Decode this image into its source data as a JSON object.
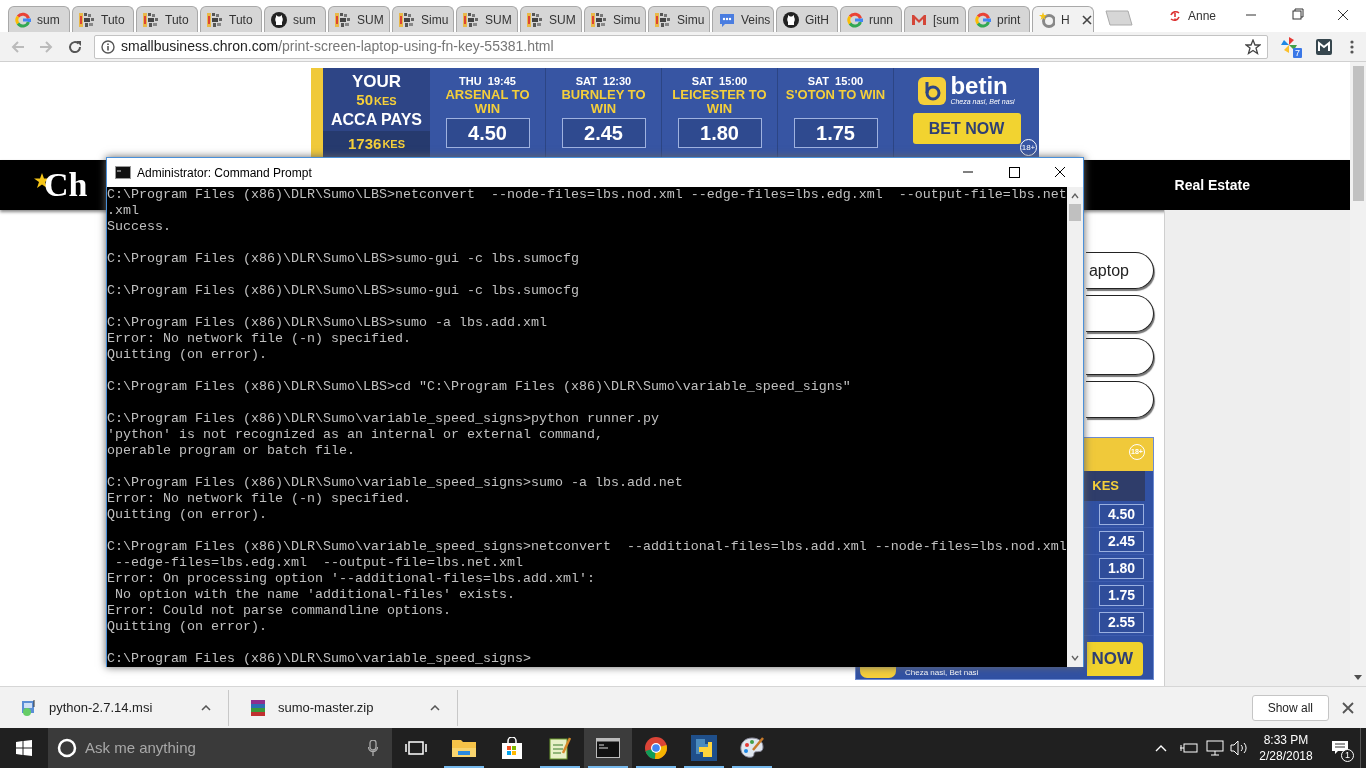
{
  "browser": {
    "tabs": [
      {
        "title": "sum",
        "kind": "ring",
        "selected": false
      },
      {
        "title": "Tuto",
        "kind": "grid",
        "selected": false
      },
      {
        "title": "Tuto",
        "kind": "grid",
        "selected": false
      },
      {
        "title": "Tuto",
        "kind": "grid",
        "selected": false
      },
      {
        "title": "sum",
        "kind": "cat",
        "selected": false
      },
      {
        "title": "SUM",
        "kind": "grid",
        "selected": false
      },
      {
        "title": "Simu",
        "kind": "grid",
        "selected": false
      },
      {
        "title": "SUM",
        "kind": "grid",
        "selected": false
      },
      {
        "title": "SUM",
        "kind": "grid",
        "selected": false
      },
      {
        "title": "Simu",
        "kind": "grid",
        "selected": false
      },
      {
        "title": "Simu",
        "kind": "grid",
        "selected": false
      },
      {
        "title": "Veins",
        "kind": "chat",
        "selected": false
      },
      {
        "title": "GitH",
        "kind": "cat",
        "selected": false
      },
      {
        "title": "runn",
        "kind": "ring",
        "selected": false
      },
      {
        "title": "[sum",
        "kind": "envelope",
        "selected": false
      },
      {
        "title": "print",
        "kind": "ring",
        "selected": false
      },
      {
        "title": "H",
        "kind": "star",
        "selected": true
      }
    ],
    "profile": "Anne",
    "address": {
      "host": "smallbusiness.chron.com",
      "path": "/print-screen-laptop-using-fn-key-55381.html"
    },
    "extension_badge": "7"
  },
  "page": {
    "banner": {
      "promo": {
        "line_1": "YOUR",
        "amount": "50",
        "amount_unit": "KES",
        "line_2": "ACCA PAYS",
        "payout": "1736",
        "payout_unit": "KES"
      },
      "matches": [
        {
          "time": "THU  19:45",
          "pick": "ARSENAL TO WIN",
          "odds": "4.50"
        },
        {
          "time": "SAT  12:30",
          "pick": "BURNLEY TO WIN",
          "odds": "2.45"
        },
        {
          "time": "SAT  15:00",
          "pick": "LEICESTER TO WIN",
          "odds": "1.80"
        },
        {
          "time": "SAT  15:00",
          "pick": "S'OTON TO WIN",
          "odds": "1.75"
        }
      ],
      "brand": "betin",
      "tagline": "Cheza nasi, Bet nasi",
      "button": "BET NOW",
      "age": "18+"
    },
    "nav": {
      "logo": "Ch",
      "links": [
        "Real Estate"
      ]
    },
    "pills": [
      {
        "kind": "text",
        "label": "aptop"
      },
      {
        "kind": "blank"
      },
      {
        "kind": "blank"
      },
      {
        "kind": "blank"
      }
    ],
    "side_ad": {
      "age": "18+",
      "unit": "KES",
      "odds": [
        "4.50",
        "2.45",
        "1.80",
        "1.75",
        "2.55"
      ],
      "button": "NOW",
      "tagline": "Cheza nasi, Bet nasi"
    }
  },
  "console_window": {
    "title": "Administrator: Command Prompt",
    "blocks": [
      [
        "C:\\Program Files (x86)\\DLR\\Sumo\\LBS>netconvert  --node-files=lbs.nod.xml --edge-files=lbs.edg.xml  --output-file=lbs.net",
        ".xml",
        "Success."
      ],
      [
        "C:\\Program Files (x86)\\DLR\\Sumo\\LBS>sumo-gui -c lbs.sumocfg"
      ],
      [
        "C:\\Program Files (x86)\\DLR\\Sumo\\LBS>sumo-gui -c lbs.sumocfg"
      ],
      [
        "C:\\Program Files (x86)\\DLR\\Sumo\\LBS>sumo -a lbs.add.xml",
        "Error: No network file (-n) specified.",
        "Quitting (on error)."
      ],
      [
        "C:\\Program Files (x86)\\DLR\\Sumo\\LBS>cd \"C:\\Program Files (x86)\\DLR\\Sumo\\variable_speed_signs\""
      ],
      [
        "C:\\Program Files (x86)\\DLR\\Sumo\\variable_speed_signs>python runner.py",
        "'python' is not recognized as an internal or external command,",
        "operable program or batch file."
      ],
      [
        "C:\\Program Files (x86)\\DLR\\Sumo\\variable_speed_signs>sumo -a lbs.add.net",
        "Error: No network file (-n) specified.",
        "Quitting (on error)."
      ],
      [
        "C:\\Program Files (x86)\\DLR\\Sumo\\variable_speed_signs>netconvert  --additional-files=lbs.add.xml --node-files=lbs.nod.xml",
        " --edge-files=lbs.edg.xml  --output-file=lbs.net.xml",
        "Error: On processing option '--additional-files=lbs.add.xml':",
        " No option with the name 'additional-files' exists.",
        "Error: Could not parse commandline options.",
        "Quitting (on error)."
      ],
      [
        "C:\\Program Files (x86)\\DLR\\Sumo\\variable_speed_signs>"
      ]
    ]
  },
  "downloads": {
    "items": [
      {
        "name": "python-2.7.14.msi",
        "kind": "installer"
      },
      {
        "name": "sumo-master.zip",
        "kind": "archive"
      }
    ],
    "button": "Show all"
  },
  "taskbar": {
    "search_placeholder": "Ask me anything",
    "apps": [
      {
        "kind": "explorer",
        "running": true,
        "selected": false
      },
      {
        "kind": "store",
        "running": false,
        "selected": false
      },
      {
        "kind": "notepad",
        "running": true,
        "selected": false
      },
      {
        "kind": "terminal",
        "running": true,
        "selected": true
      },
      {
        "kind": "browser",
        "running": true,
        "selected": false
      },
      {
        "kind": "python",
        "running": true,
        "selected": false
      },
      {
        "kind": "paint",
        "running": true,
        "selected": false
      }
    ],
    "time": "8:33 PM",
    "date": "2/28/2018",
    "notifications": "1"
  }
}
